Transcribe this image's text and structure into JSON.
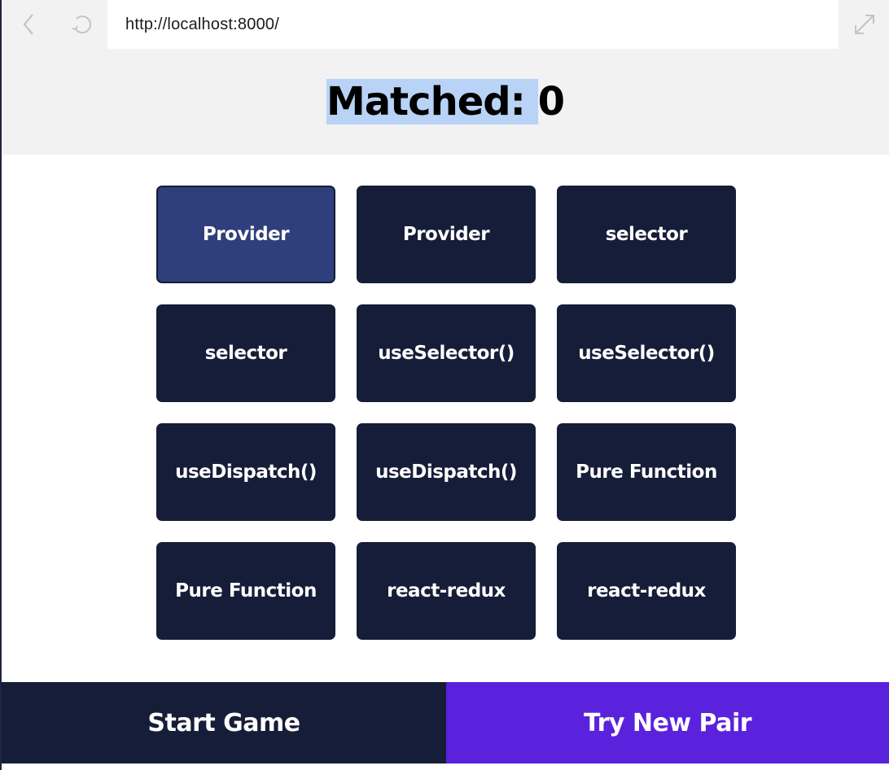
{
  "browser": {
    "url": "http://localhost:8000/",
    "icons": {
      "back": "chevron-left-icon",
      "reload": "reload-icon",
      "expand": "expand-icon"
    }
  },
  "score": {
    "label": "Matched: ",
    "value": "0"
  },
  "cards": [
    {
      "label": "Provider",
      "selected": true
    },
    {
      "label": "Provider",
      "selected": false
    },
    {
      "label": "selector",
      "selected": false
    },
    {
      "label": "selector",
      "selected": false
    },
    {
      "label": "useSelector()",
      "selected": false
    },
    {
      "label": "useSelector()",
      "selected": false
    },
    {
      "label": "useDispatch()",
      "selected": false
    },
    {
      "label": "useDispatch()",
      "selected": false
    },
    {
      "label": "Pure Function",
      "selected": false
    },
    {
      "label": "Pure Function",
      "selected": false
    },
    {
      "label": "react-redux",
      "selected": false
    },
    {
      "label": "react-redux",
      "selected": false
    }
  ],
  "footer": {
    "start_label": "Start Game",
    "pair_label": "Try New Pair"
  },
  "colors": {
    "card": "#151d38",
    "card_selected": "#2f3f7c",
    "start_button": "#151d38",
    "pair_button": "#5a22dc",
    "score_highlight": "#b8d3f5",
    "header_bg": "#f2f2f2"
  }
}
